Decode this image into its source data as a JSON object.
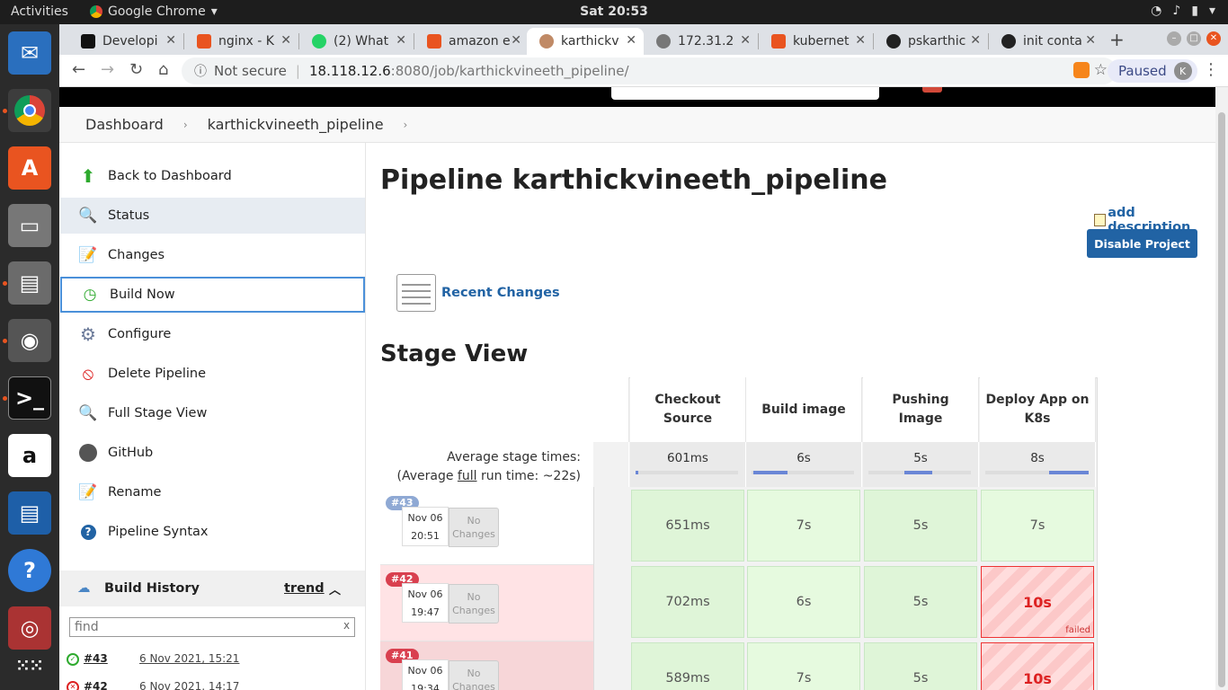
{
  "topbar": {
    "activities": "Activities",
    "app": "Google Chrome",
    "clock": "Sat 20:53"
  },
  "chrome": {
    "tabs": [
      {
        "title": "Developi",
        "icon_color": "#111111"
      },
      {
        "title": "nginx - K",
        "icon_color": "#e95420"
      },
      {
        "title": "(2) What",
        "icon_color": "#25d366"
      },
      {
        "title": "amazon e",
        "icon_color": "#e95420"
      },
      {
        "title": "karthickv",
        "icon_color": "#c08a66"
      },
      {
        "title": "172.31.2",
        "icon_color": "#777777"
      },
      {
        "title": "kubernet",
        "icon_color": "#e95420"
      },
      {
        "title": "pskarthic",
        "icon_color": "#222222"
      },
      {
        "title": "init conta",
        "icon_color": "#222222"
      }
    ],
    "active_tab": 4,
    "security": "Not secure",
    "url_host": "18.118.12.6",
    "url_path": ":8080/job/karthickvineeth_pipeline/",
    "profile_label": "Paused",
    "profile_initial": "K"
  },
  "breadcrumb": {
    "home": "Dashboard",
    "job": "karthickvineeth_pipeline"
  },
  "sidepanel": {
    "tasks": [
      {
        "label": "Back to Dashboard",
        "icon": "up-arrow-icon"
      },
      {
        "label": "Status",
        "icon": "magnifier-icon"
      },
      {
        "label": "Changes",
        "icon": "notepad-icon"
      },
      {
        "label": "Build Now",
        "icon": "clock-play-icon"
      },
      {
        "label": "Configure",
        "icon": "gear-icon"
      },
      {
        "label": "Delete Pipeline",
        "icon": "no-entry-icon"
      },
      {
        "label": "Full Stage View",
        "icon": "magnifier-icon"
      },
      {
        "label": "GitHub",
        "icon": "github-icon"
      },
      {
        "label": "Rename",
        "icon": "notepad-icon"
      },
      {
        "label": "Pipeline Syntax",
        "icon": "help-icon"
      }
    ],
    "build_history": {
      "title": "Build History",
      "trend": "trend",
      "find_placeholder": "find",
      "find_clear": "x",
      "rows": [
        {
          "number": "#43",
          "date": "6 Nov 2021, 15:21",
          "status": "success"
        },
        {
          "number": "#42",
          "date": "6 Nov 2021, 14:17",
          "status": "failed"
        }
      ]
    }
  },
  "main": {
    "title": "Pipeline karthickvineeth_pipeline",
    "add_description": "add description",
    "disable_button": "Disable Project",
    "recent_changes": "Recent Changes",
    "stage_view_title": "Stage View",
    "avg_label_1": "Average stage times:",
    "avg_label_2_pre": "(Average ",
    "avg_label_2_link": "full",
    "avg_label_2_post": " run time: ~22s)",
    "stages": [
      {
        "name": "Checkout Source",
        "avg": "601ms",
        "bar_fraction": 0.02
      },
      {
        "name": "Build image",
        "avg": "6s",
        "bar_fraction": 0.33
      },
      {
        "name": "Pushing Image",
        "avg": "5s",
        "bar_fraction": 0.27
      },
      {
        "name": "Deploy App on K8s",
        "avg": "8s",
        "bar_fraction": 0.38
      }
    ],
    "runs": [
      {
        "tag": "#43",
        "tag_color": "#8fa9d4",
        "date": "Nov 06",
        "time": "20:51",
        "changes": "No Changes",
        "row_bg": "#ffffff",
        "cells": [
          {
            "v": "651ms",
            "s": "ok"
          },
          {
            "v": "7s",
            "s": "ok"
          },
          {
            "v": "5s",
            "s": "ok"
          },
          {
            "v": "7s",
            "s": "ok"
          }
        ]
      },
      {
        "tag": "#42",
        "tag_color": "#d9404f",
        "date": "Nov 06",
        "time": "19:47",
        "changes": "No Changes",
        "row_bg": "#ffe3e5",
        "cells": [
          {
            "v": "702ms",
            "s": "ok"
          },
          {
            "v": "6s",
            "s": "ok"
          },
          {
            "v": "5s",
            "s": "ok"
          },
          {
            "v": "10s",
            "s": "fail",
            "note": "failed"
          }
        ]
      },
      {
        "tag": "#41",
        "tag_color": "#d9404f",
        "date": "Nov 06",
        "time": "19:34",
        "changes": "No Changes",
        "row_bg": "#f7d6d8",
        "cells": [
          {
            "v": "589ms",
            "s": "ok"
          },
          {
            "v": "7s",
            "s": "ok"
          },
          {
            "v": "5s",
            "s": "ok"
          },
          {
            "v": "10s",
            "s": "fail"
          }
        ]
      }
    ]
  }
}
